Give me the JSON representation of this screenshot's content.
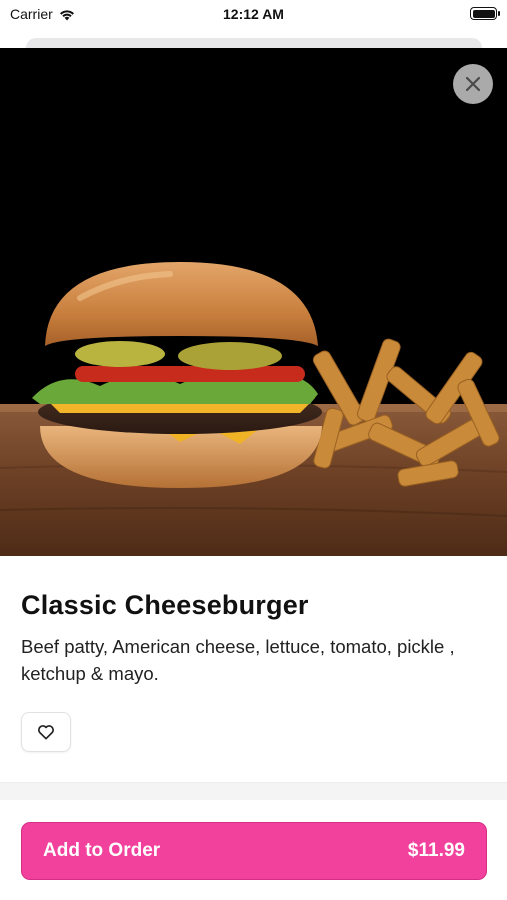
{
  "status_bar": {
    "carrier": "Carrier",
    "time": "12:12 AM",
    "icons": [
      "wifi-icon",
      "battery-icon"
    ]
  },
  "hero": {
    "image_subject": "cheeseburger-with-fries-photo",
    "close_icon": "close-icon"
  },
  "item": {
    "title": "Classic Cheeseburger",
    "description": "Beef patty, American cheese, lettuce, tomato, pickle , ketchup & mayo.",
    "favorite_icon": "heart-icon"
  },
  "order": {
    "button_label": "Add to Order",
    "price": "$11.99",
    "accent_color": "#f2409d"
  }
}
